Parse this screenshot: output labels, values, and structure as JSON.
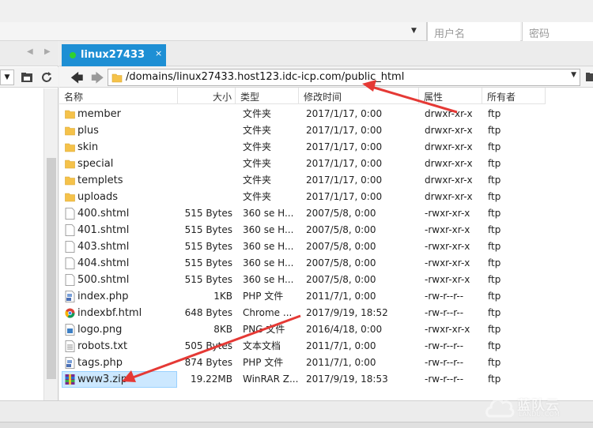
{
  "login": {
    "user_placeholder": "用户名",
    "pass_placeholder": "密码"
  },
  "tab": {
    "label": "linux27433",
    "close": "×"
  },
  "path": {
    "value": "/domains/linux27433.host123.idc-icp.com/public_html"
  },
  "columns": {
    "name": "名称",
    "size": "大小",
    "type": "类型",
    "modified": "修改时间",
    "attributes": "属性",
    "owner": "所有者"
  },
  "files": [
    {
      "icon": "folder-icon",
      "name": "member",
      "size": "",
      "type": "文件夹",
      "modified": "2017/1/17, 0:00",
      "perm": "drwxr-xr-x",
      "owner": "ftp"
    },
    {
      "icon": "folder-icon",
      "name": "plus",
      "size": "",
      "type": "文件夹",
      "modified": "2017/1/17, 0:00",
      "perm": "drwxr-xr-x",
      "owner": "ftp"
    },
    {
      "icon": "folder-icon",
      "name": "skin",
      "size": "",
      "type": "文件夹",
      "modified": "2017/1/17, 0:00",
      "perm": "drwxr-xr-x",
      "owner": "ftp"
    },
    {
      "icon": "folder-icon",
      "name": "special",
      "size": "",
      "type": "文件夹",
      "modified": "2017/1/17, 0:00",
      "perm": "drwxr-xr-x",
      "owner": "ftp"
    },
    {
      "icon": "folder-icon",
      "name": "templets",
      "size": "",
      "type": "文件夹",
      "modified": "2017/1/17, 0:00",
      "perm": "drwxr-xr-x",
      "owner": "ftp"
    },
    {
      "icon": "folder-icon",
      "name": "uploads",
      "size": "",
      "type": "文件夹",
      "modified": "2017/1/17, 0:00",
      "perm": "drwxr-xr-x",
      "owner": "ftp"
    },
    {
      "icon": "file-icon",
      "name": "400.shtml",
      "size": "515 Bytes",
      "type": "360 se H...",
      "modified": "2007/5/8, 0:00",
      "perm": "-rwxr-xr-x",
      "owner": "ftp"
    },
    {
      "icon": "file-icon",
      "name": "401.shtml",
      "size": "515 Bytes",
      "type": "360 se H...",
      "modified": "2007/5/8, 0:00",
      "perm": "-rwxr-xr-x",
      "owner": "ftp"
    },
    {
      "icon": "file-icon",
      "name": "403.shtml",
      "size": "515 Bytes",
      "type": "360 se H...",
      "modified": "2007/5/8, 0:00",
      "perm": "-rwxr-xr-x",
      "owner": "ftp"
    },
    {
      "icon": "file-icon",
      "name": "404.shtml",
      "size": "515 Bytes",
      "type": "360 se H...",
      "modified": "2007/5/8, 0:00",
      "perm": "-rwxr-xr-x",
      "owner": "ftp"
    },
    {
      "icon": "file-icon",
      "name": "500.shtml",
      "size": "515 Bytes",
      "type": "360 se H...",
      "modified": "2007/5/8, 0:00",
      "perm": "-rwxr-xr-x",
      "owner": "ftp"
    },
    {
      "icon": "php-file-icon",
      "name": "index.php",
      "size": "1KB",
      "type": "PHP 文件",
      "modified": "2011/7/1, 0:00",
      "perm": "-rw-r--r--",
      "owner": "ftp"
    },
    {
      "icon": "chrome-icon",
      "name": "indexbf.html",
      "size": "648 Bytes",
      "type": "Chrome ...",
      "modified": "2017/9/19, 18:52",
      "perm": "-rw-r--r--",
      "owner": "ftp"
    },
    {
      "icon": "image-file-icon",
      "name": "logo.png",
      "size": "8KB",
      "type": "PNG 文件",
      "modified": "2016/4/18, 0:00",
      "perm": "-rwxr-xr-x",
      "owner": "ftp"
    },
    {
      "icon": "text-file-icon",
      "name": "robots.txt",
      "size": "505 Bytes",
      "type": "文本文档",
      "modified": "2011/7/1, 0:00",
      "perm": "-rw-r--r--",
      "owner": "ftp"
    },
    {
      "icon": "php-file-icon",
      "name": "tags.php",
      "size": "874 Bytes",
      "type": "PHP 文件",
      "modified": "2011/7/1, 0:00",
      "perm": "-rw-r--r--",
      "owner": "ftp"
    },
    {
      "icon": "winrar-icon",
      "name": "www3.zip",
      "size": "19.22MB",
      "type": "WinRAR Z...",
      "modified": "2017/9/19, 18:53",
      "perm": "-rw-r--r--",
      "owner": "ftp"
    }
  ],
  "watermark": {
    "name": "蓝队云",
    "sub": "LANDUI.COM"
  },
  "colors": {
    "accent": "#1e8fd4",
    "annotation": "#e53935",
    "selection": "#cce8ff",
    "folder": "#f5c24a"
  }
}
